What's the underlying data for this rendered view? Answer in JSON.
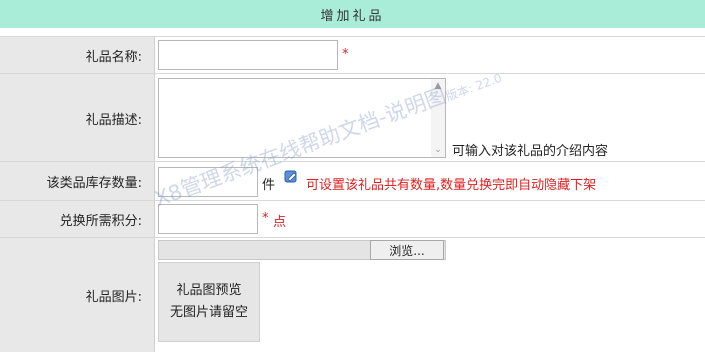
{
  "header": {
    "title": "增加礼品"
  },
  "form": {
    "name": {
      "label": "礼品名称:",
      "value": "",
      "required_mark": "*"
    },
    "desc": {
      "label": "礼品描述:",
      "value": "",
      "hint": "可输入对该礼品的介绍内容"
    },
    "stock": {
      "label": "该类品库存数量:",
      "value": "",
      "unit": "件",
      "hint": "可设置该礼品共有数量,数量兑换完即自动隐藏下架"
    },
    "points": {
      "label": "兑换所需积分:",
      "value": "",
      "required_mark": "*",
      "unit": "点"
    },
    "image": {
      "label": "礼品图片:",
      "browse_label": "浏览...",
      "preview_line1": "礼品图预览",
      "preview_line2": "无图片请留空"
    }
  },
  "watermark": {
    "text": "X8管理系统在线帮助文档-说明图",
    "version": "版本: 22.0"
  },
  "colors": {
    "header_bg": "#a9ecd7",
    "label_bg": "#e8e8e8",
    "required": "#e02020"
  }
}
